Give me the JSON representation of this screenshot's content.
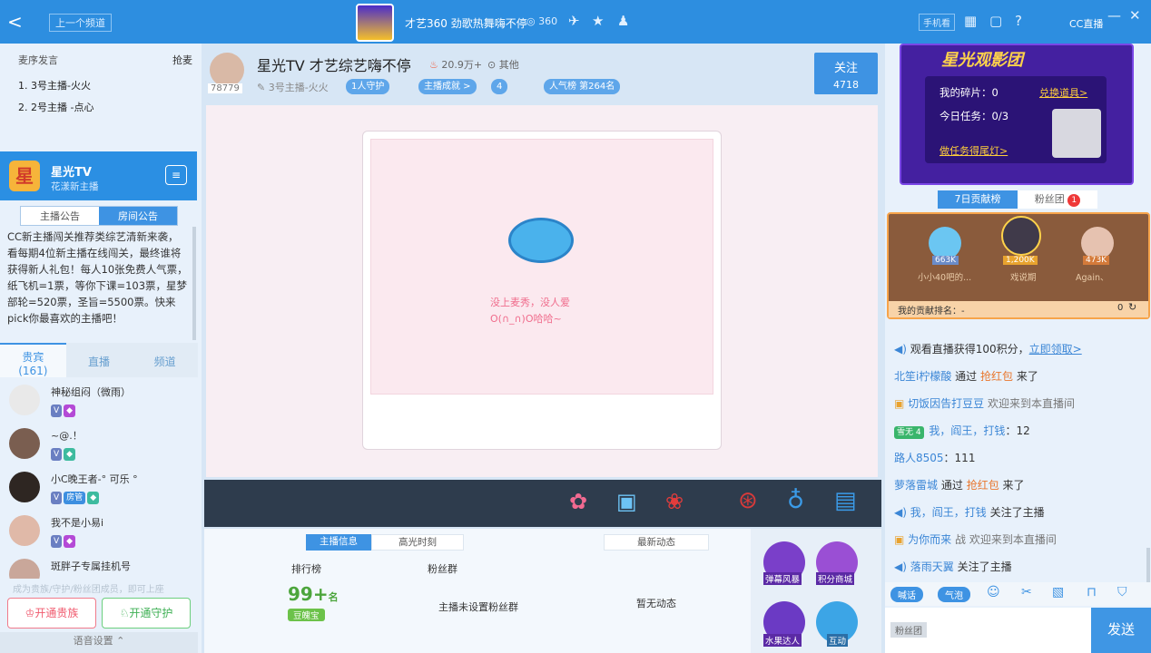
{
  "topbar": {
    "back": "<",
    "prev_label": "上一个频道",
    "title": "才艺360 劲歌热舞嗨不停",
    "room_num": "360",
    "phone_label": "手机看",
    "brand": "CC直播"
  },
  "left": {
    "seat_title": "麦序发言",
    "grab_label": "抢麦",
    "seats": [
      {
        "label": "1. 3号主播-火火"
      },
      {
        "label": "2. 2号主播 -点心"
      }
    ],
    "anchor": {
      "name": "星光TV",
      "sub": "花漾新主播"
    },
    "notice_tabs": [
      "主播公告",
      "房间公告"
    ],
    "notice_text": "CC新主播闯关推荐类综艺清新来袭，看每期4位新主播在线闯关，最终谁将获得新人礼包！每人10张免费人气票，纸飞机=1票，等你下课=103票，星梦部轮=520票，圣旨=5500票。快来pick你最喜欢的主播吧！",
    "user_tabs": [
      {
        "label": "贵宾",
        "count": "(161)"
      },
      {
        "label": "直播"
      },
      {
        "label": "频道"
      }
    ],
    "users": [
      {
        "name": "神秘组闷（微雨）"
      },
      {
        "name": "~@.！"
      },
      {
        "name": "小C晚王者-° 可乐 °"
      },
      {
        "name": "我不是小易i"
      },
      {
        "name": "斑胖子专属挂机号"
      }
    ],
    "join_hint": "成为贵族/守护/粉丝团成员，即可上座",
    "btn_noble": "开通贵族",
    "btn_guard": "开通守护",
    "voice_settings": "语音设置"
  },
  "center": {
    "anchor_name": "星光TV 才艺综艺嗨不停",
    "heat": "20.9万+",
    "other": "其他",
    "fans_id": "78779",
    "anchor_label": "3号主播-火火",
    "guard": "1人守护",
    "achievement": "主播成就 >",
    "fans_count": "4",
    "rank": "人气榜 第264名",
    "follow_label": "关注",
    "follow_count": "4718",
    "empty_line1": "没上麦秀，没人爱",
    "empty_line2": "O(∩_∩)O哈哈~",
    "info_tabs": [
      "主播信息",
      "高光时刻"
    ],
    "news_tab": "最新动态",
    "rank_label": "排行榜",
    "rank_value": "99+",
    "rank_unit": "名",
    "rank_badge": "豆魄宝",
    "fanclub_label": "粉丝群",
    "fanclub_value": "主播未设置粉丝群",
    "news_value": "暂无动态",
    "side_apps": [
      "弹幕风暴",
      "积分商城",
      "水果达人",
      "互动"
    ]
  },
  "right": {
    "banner_title": "星光观影团",
    "fragments": "我的碎片：0",
    "redeem": "兑换道具>",
    "task": "今日任务：0/3",
    "do_task": "做任务得尾灯>",
    "tab_contrib": "7日贡献榜",
    "tab_fans": "粉丝团",
    "fans_badge": "1",
    "podium": [
      {
        "name": "小小40吧的...",
        "score": "663K"
      },
      {
        "name": "戏说期",
        "score": "1,200K"
      },
      {
        "name": "Again、",
        "score": "473K"
      }
    ],
    "my_rank": "我的贡献排名：-",
    "my_rank_val": "0",
    "chat": [
      {
        "user": "北笙i柠檬酸",
        "mid": "通过",
        "action": "抢红包",
        "tail": "来了"
      },
      {
        "user": "切饭因告打豆豆",
        "tail": "欢迎来到本直播间"
      },
      {
        "user": "我，阎王，打钱",
        "tail": "：12"
      },
      {
        "user": "路人8505",
        "tail": "：111"
      },
      {
        "user": "萝落雷城",
        "mid": "通过",
        "action": "抢红包",
        "tail": "来了"
      },
      {
        "user": "我，阎王，打钱",
        "tail": "关注了主播"
      },
      {
        "user": "为你而来",
        "tail": "战 欢迎来到本直播间"
      },
      {
        "user": "落雨天翼",
        "tail": "关注了主播"
      }
    ],
    "system_msg": "观看直播获得100积分，",
    "system_link": "立即领取>",
    "input_tabs": [
      "喊话",
      "气泡"
    ],
    "fan_group_btn": "粉丝团",
    "send": "发送"
  }
}
